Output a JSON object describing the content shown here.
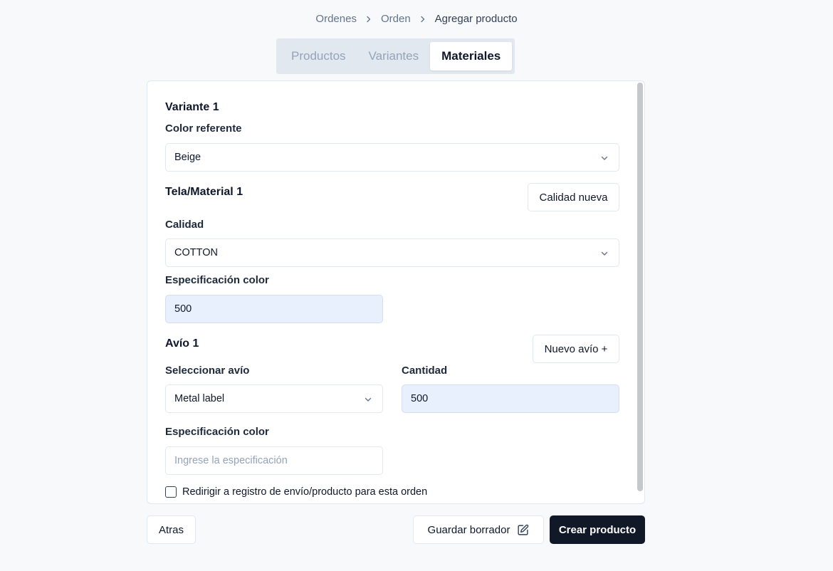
{
  "breadcrumb": {
    "items": [
      "Ordenes",
      "Orden",
      "Agregar producto"
    ]
  },
  "tabs": [
    {
      "label": "Productos",
      "active": false
    },
    {
      "label": "Variantes",
      "active": false
    },
    {
      "label": "Materiales",
      "active": true
    }
  ],
  "variant": {
    "title": "Variante 1",
    "color_label": "Color referente",
    "color_value": "Beige"
  },
  "fabric": {
    "title": "Tela/Material 1",
    "new_quality_button": "Calidad nueva",
    "quality_label": "Calidad",
    "quality_value": "COTTON",
    "color_spec_label": "Especificación color",
    "color_spec_value": "500"
  },
  "trim": {
    "title": "Avío 1",
    "new_trim_button": "Nuevo avío +",
    "select_label": "Seleccionar avío",
    "select_value": "Metal label",
    "quantity_label": "Cantidad",
    "quantity_value": "500",
    "color_spec_label": "Especificación color",
    "color_spec_placeholder": "Ingrese la especificación"
  },
  "redirect_checkbox": {
    "label": "Redirigir a registro de envío/producto para esta orden",
    "checked": false
  },
  "footer": {
    "back_button": "Atras",
    "save_draft_button": "Guardar borrador",
    "create_button": "Crear producto"
  },
  "icons": {
    "breadcrumb_separator": "chevron-right-icon",
    "select_arrow": "chevron-down-icon",
    "save_draft": "edit-icon"
  },
  "colors": {
    "primary_dark": "#111827",
    "filled_input_bg": "#e8f0fe",
    "tab_bar_bg": "#e2e8f0"
  }
}
